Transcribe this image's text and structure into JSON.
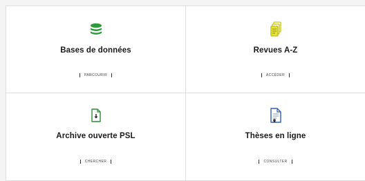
{
  "tiles": [
    {
      "title": "Bases de données",
      "action": "PARCOURIR",
      "icon": "database-icon"
    },
    {
      "title": "Revues A-Z",
      "action": "ACCÉDER",
      "icon": "journals-icon"
    },
    {
      "title": "Archive ouverte PSL",
      "action": "CHERCHER",
      "icon": "download-document-icon"
    },
    {
      "title": "Thèses en ligne",
      "action": "CONSULTER",
      "icon": "thesis-document-icon"
    }
  ],
  "colors": {
    "database_green": "#2e9b3a",
    "journals_yellow": "#d8d832",
    "archive_green": "#2e8b3a",
    "thesis_blue": "#2f5fa8",
    "border": "#dedede"
  }
}
